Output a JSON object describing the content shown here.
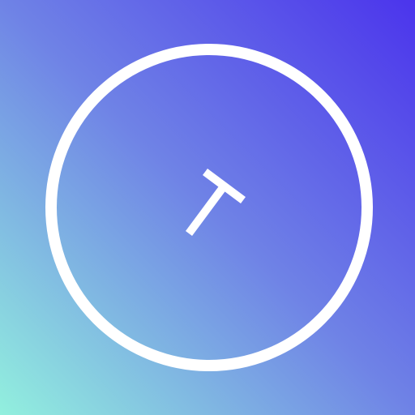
{
  "app_icon": {
    "icon": "clock-ring-icon",
    "colors": {
      "gradient_top_right": "#4B34EC",
      "gradient_middle": "#6F83E6",
      "gradient_bottom_left": "#92F0DE",
      "ring": "#FFFFFF",
      "glyph": "#FFFFFF"
    }
  }
}
